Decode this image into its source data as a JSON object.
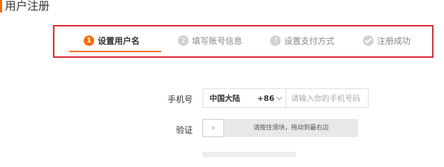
{
  "page": {
    "title": "用户注册"
  },
  "steps": [
    {
      "number": "1",
      "label": "设置用户名",
      "active": true
    },
    {
      "number": "2",
      "label": "填写账号信息",
      "active": false
    },
    {
      "number": "3",
      "label": "设置支付方式",
      "active": false
    },
    {
      "number": "",
      "label": "注册成功",
      "active": false
    }
  ],
  "form": {
    "phone_label": "手机号",
    "country": "中国大陆",
    "country_code": "+86",
    "phone_placeholder": "请输入你的手机号码",
    "verify_label": "验证",
    "slider_handle": "»",
    "slider_text": "请按住滑块，拖动到最右边"
  },
  "colors": {
    "accent": "#ff6a00",
    "highlight_border": "#d9242d",
    "inactive_step": "#d0d0d0"
  }
}
